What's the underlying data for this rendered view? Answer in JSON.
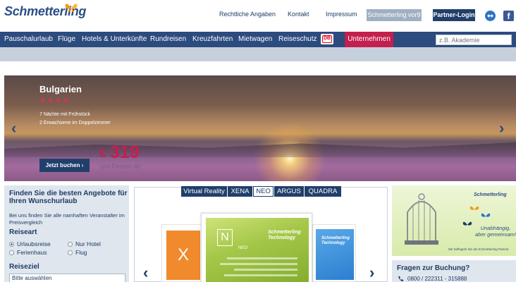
{
  "brand": {
    "name": "Schmetterling"
  },
  "top_links": {
    "legal": "Rechtliche Angaben",
    "contact": "Kontakt",
    "imprint": "Impressum",
    "schmetterling_vor9": "Schmetterling vor9",
    "partner_login": "Partner-Login",
    "icons": [
      "teamviewer-icon",
      "facebook-icon"
    ],
    "facebook_glyph": "f"
  },
  "nav": {
    "items": [
      "Pauschalurlaub",
      "Flüge",
      "Hotels & Unterkünfte",
      "Rundreisen",
      "Kreuzfahrten",
      "Mietwagen",
      "Reiseschutz"
    ],
    "db_label": "DB",
    "company": "Unternehmen",
    "search_placeholder": "z.B. Akademie"
  },
  "hero": {
    "title": "Bulgarien",
    "stars": "★★★★",
    "rating": 4,
    "line1": "7 Nächte mit Frühstück",
    "line2": "2 Erwachsene im Doppelzimmer",
    "currency": "€",
    "price": "319",
    "price_note": "pro Person ab",
    "cta": "Jetzt buchen ›",
    "prev_arrow": "‹",
    "next_arrow": "›"
  },
  "search_box": {
    "title": "Finden Sie die besten Angebote für Ihren Wunschurlaub",
    "subtitle": "Bei uns finden Sie alle namhaften Veranstalter im Preisvergleich",
    "travel_type_label": "Reiseart",
    "options": [
      "Urlaubsreise",
      "Nur Hotel",
      "Ferienhaus",
      "Flug"
    ],
    "selected": "Urlaubsreise",
    "destination_label": "Reiseziel",
    "destination_value": "Bitte auswählen"
  },
  "products": {
    "tabs": [
      "Virtual Reality",
      "XENA",
      "NEO",
      "ARGUS",
      "QUADRA"
    ],
    "active_tab": "NEO",
    "main_card_letter": "N",
    "main_card_name": "NEO",
    "card_brand": "Schmetterling",
    "card_brand_sub": "Technology",
    "left_card_letter": "X",
    "prev_arrow": "‹",
    "next_arrow": "›"
  },
  "ad": {
    "brand": "Schmetterling",
    "tagline": "Unabhängig, aber gemeinsam!",
    "small_print": "Wir beflügeln Sie als Schmetterling Partner."
  },
  "booking": {
    "title": "Fragen zur Buchung?",
    "phone": "0800 / 222311 - 315888"
  },
  "colors": {
    "nav_bg": "#2c4b7e",
    "accent_red": "#c41f4f",
    "dark_blue": "#213f6b",
    "panel_bg": "#dfe6ee"
  }
}
